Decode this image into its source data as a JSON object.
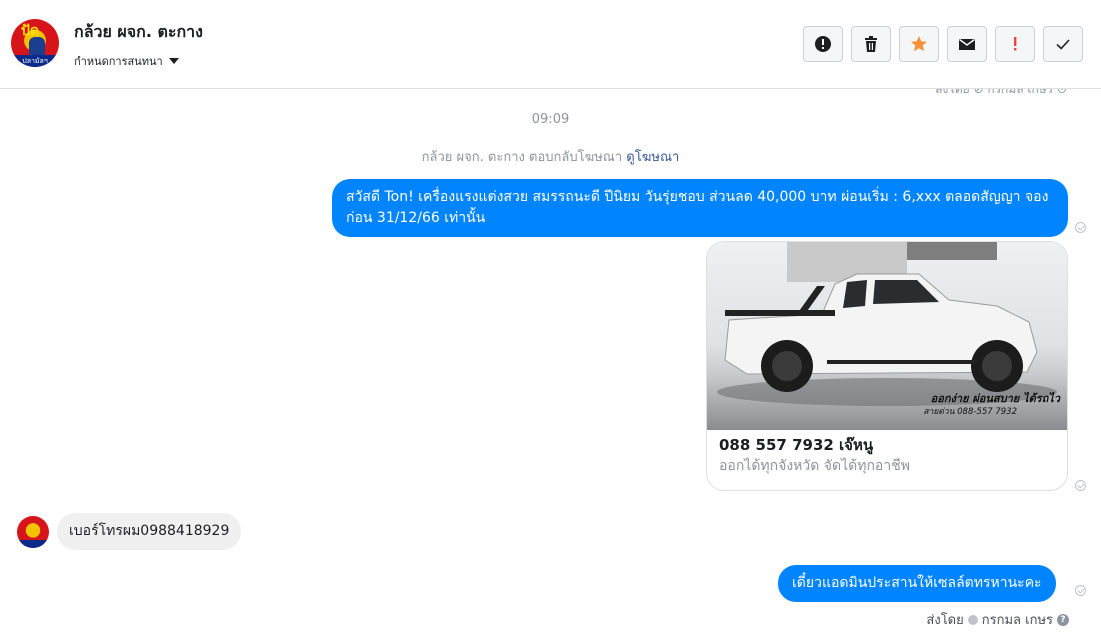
{
  "header": {
    "title": "กล้วย ผจก. ตะกาง",
    "subtitle": "กำหนดการสนทนา",
    "avatar_text": "ปัด",
    "avatar_band": "ปลามัลฯ"
  },
  "toolbar": {
    "buttons": [
      {
        "icon": "alert-circle-icon"
      },
      {
        "icon": "trash-icon"
      },
      {
        "icon": "star-icon",
        "color": "#f7923b"
      },
      {
        "icon": "envelope-icon"
      },
      {
        "icon": "exclamation-icon",
        "color": "#fa3e3e"
      },
      {
        "icon": "checkmark-icon"
      }
    ]
  },
  "top_clipped": "ส่งโดย ⊘ กรกมล เกษร ⊙",
  "thread": {
    "time": "09:09",
    "reply_notice": "กล้วย ผจก. ตะกาง ตอบกลับโฆษณา",
    "reply_link": "ดูโฆษณา",
    "msg1": "สวัสดี Ton! เครื่องแรงแต่งสวย สมรรถนะดี ปีนิยม วันรุ่ยชอบ ส่วนลด 40,000 บาท ผ่อนเริ่ม : 6,xxx ตลอดสัญญา จองก่อน 31/12/66 เท่านั้น",
    "card": {
      "overlay_line1": "ออกง่าย ผ่อนสบาย ได้รถไว",
      "overlay_line2": "สายด่วน 088-557 7932",
      "title": "088 557 7932 เจ๊หนู",
      "subtitle": "ออกได้ทุกจังหวัด จัดได้ทุกอาชีพ"
    },
    "msg_in": "เบอร์โทรผม0988418929",
    "msg3": "เดี๋ยวแอดมินประสานให้เซลล์ตทรหานะคะ",
    "sent_by_label": "ส่งโดย",
    "sent_by_name": "กรกมล เกษร"
  },
  "colors": {
    "accent": "#0084ff",
    "bubble_in": "#f1f0f0",
    "link": "#385898"
  }
}
